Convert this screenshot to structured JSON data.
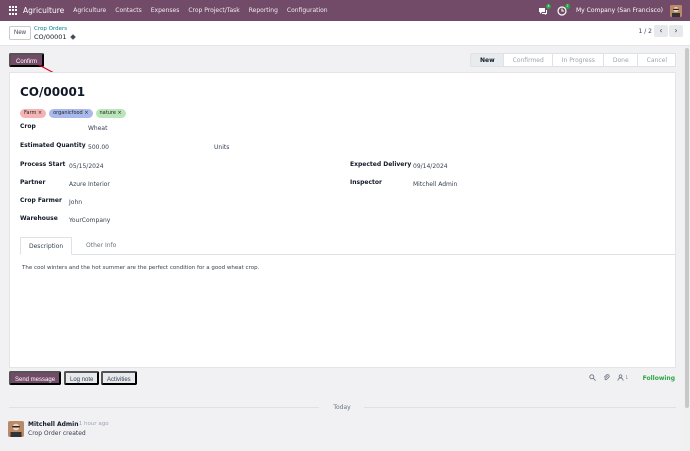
{
  "navbar": {
    "app_name": "Agriculture",
    "menu": [
      "Agriculture",
      "Contacts",
      "Expenses",
      "Crop Project/Task",
      "Reporting",
      "Configuration"
    ],
    "chat_badge": "4",
    "activity_badge": "7",
    "company": "My Company (San Francisco)"
  },
  "control": {
    "new_label": "New",
    "breadcrumb_parent": "Crop Orders",
    "breadcrumb_current": "CO/00001",
    "pager": "1 / 2",
    "prev_icon": "chevron-left-icon",
    "next_icon": "chevron-right-icon"
  },
  "status": {
    "confirm_label": "Confirm",
    "stages": [
      "New",
      "Confirmed",
      "In Progress",
      "Done",
      "Cancel"
    ],
    "active_stage": "New"
  },
  "form": {
    "title": "CO/00001",
    "tags": [
      {
        "label": "Farm",
        "color": "#f5b4b4"
      },
      {
        "label": "organicfood",
        "color": "#a9b9ee"
      },
      {
        "label": "nature",
        "color": "#b8e6b8"
      }
    ],
    "crop_label": "Crop",
    "crop_value": "Wheat",
    "qty_label": "Estimated Quantity",
    "qty_value": "500.00",
    "qty_unit": "Units",
    "start_label": "Process Start",
    "start_value": "05/15/2024",
    "delivery_label": "Expected Delivery",
    "delivery_value": "09/14/2024",
    "partner_label": "Partner",
    "partner_value": "Azure Interior",
    "inspector_label": "Inspector",
    "inspector_value": "Mitchell Admin",
    "farmer_label": "Crop Farmer",
    "farmer_value": "John",
    "warehouse_label": "Warehouse",
    "warehouse_value": "YourCompany",
    "tabs": [
      "Description",
      "Other Info"
    ],
    "description": "The cool winters and the hot summer are the perfect condition for a good wheat crop."
  },
  "chatter": {
    "send_label": "Send message",
    "log_label": "Log note",
    "activities_label": "Activities",
    "follower_count": "1",
    "following_label": "Following",
    "today_label": "Today",
    "author": "Mitchell Admin",
    "time": "- 1 hour ago",
    "body": "Crop Order created"
  }
}
